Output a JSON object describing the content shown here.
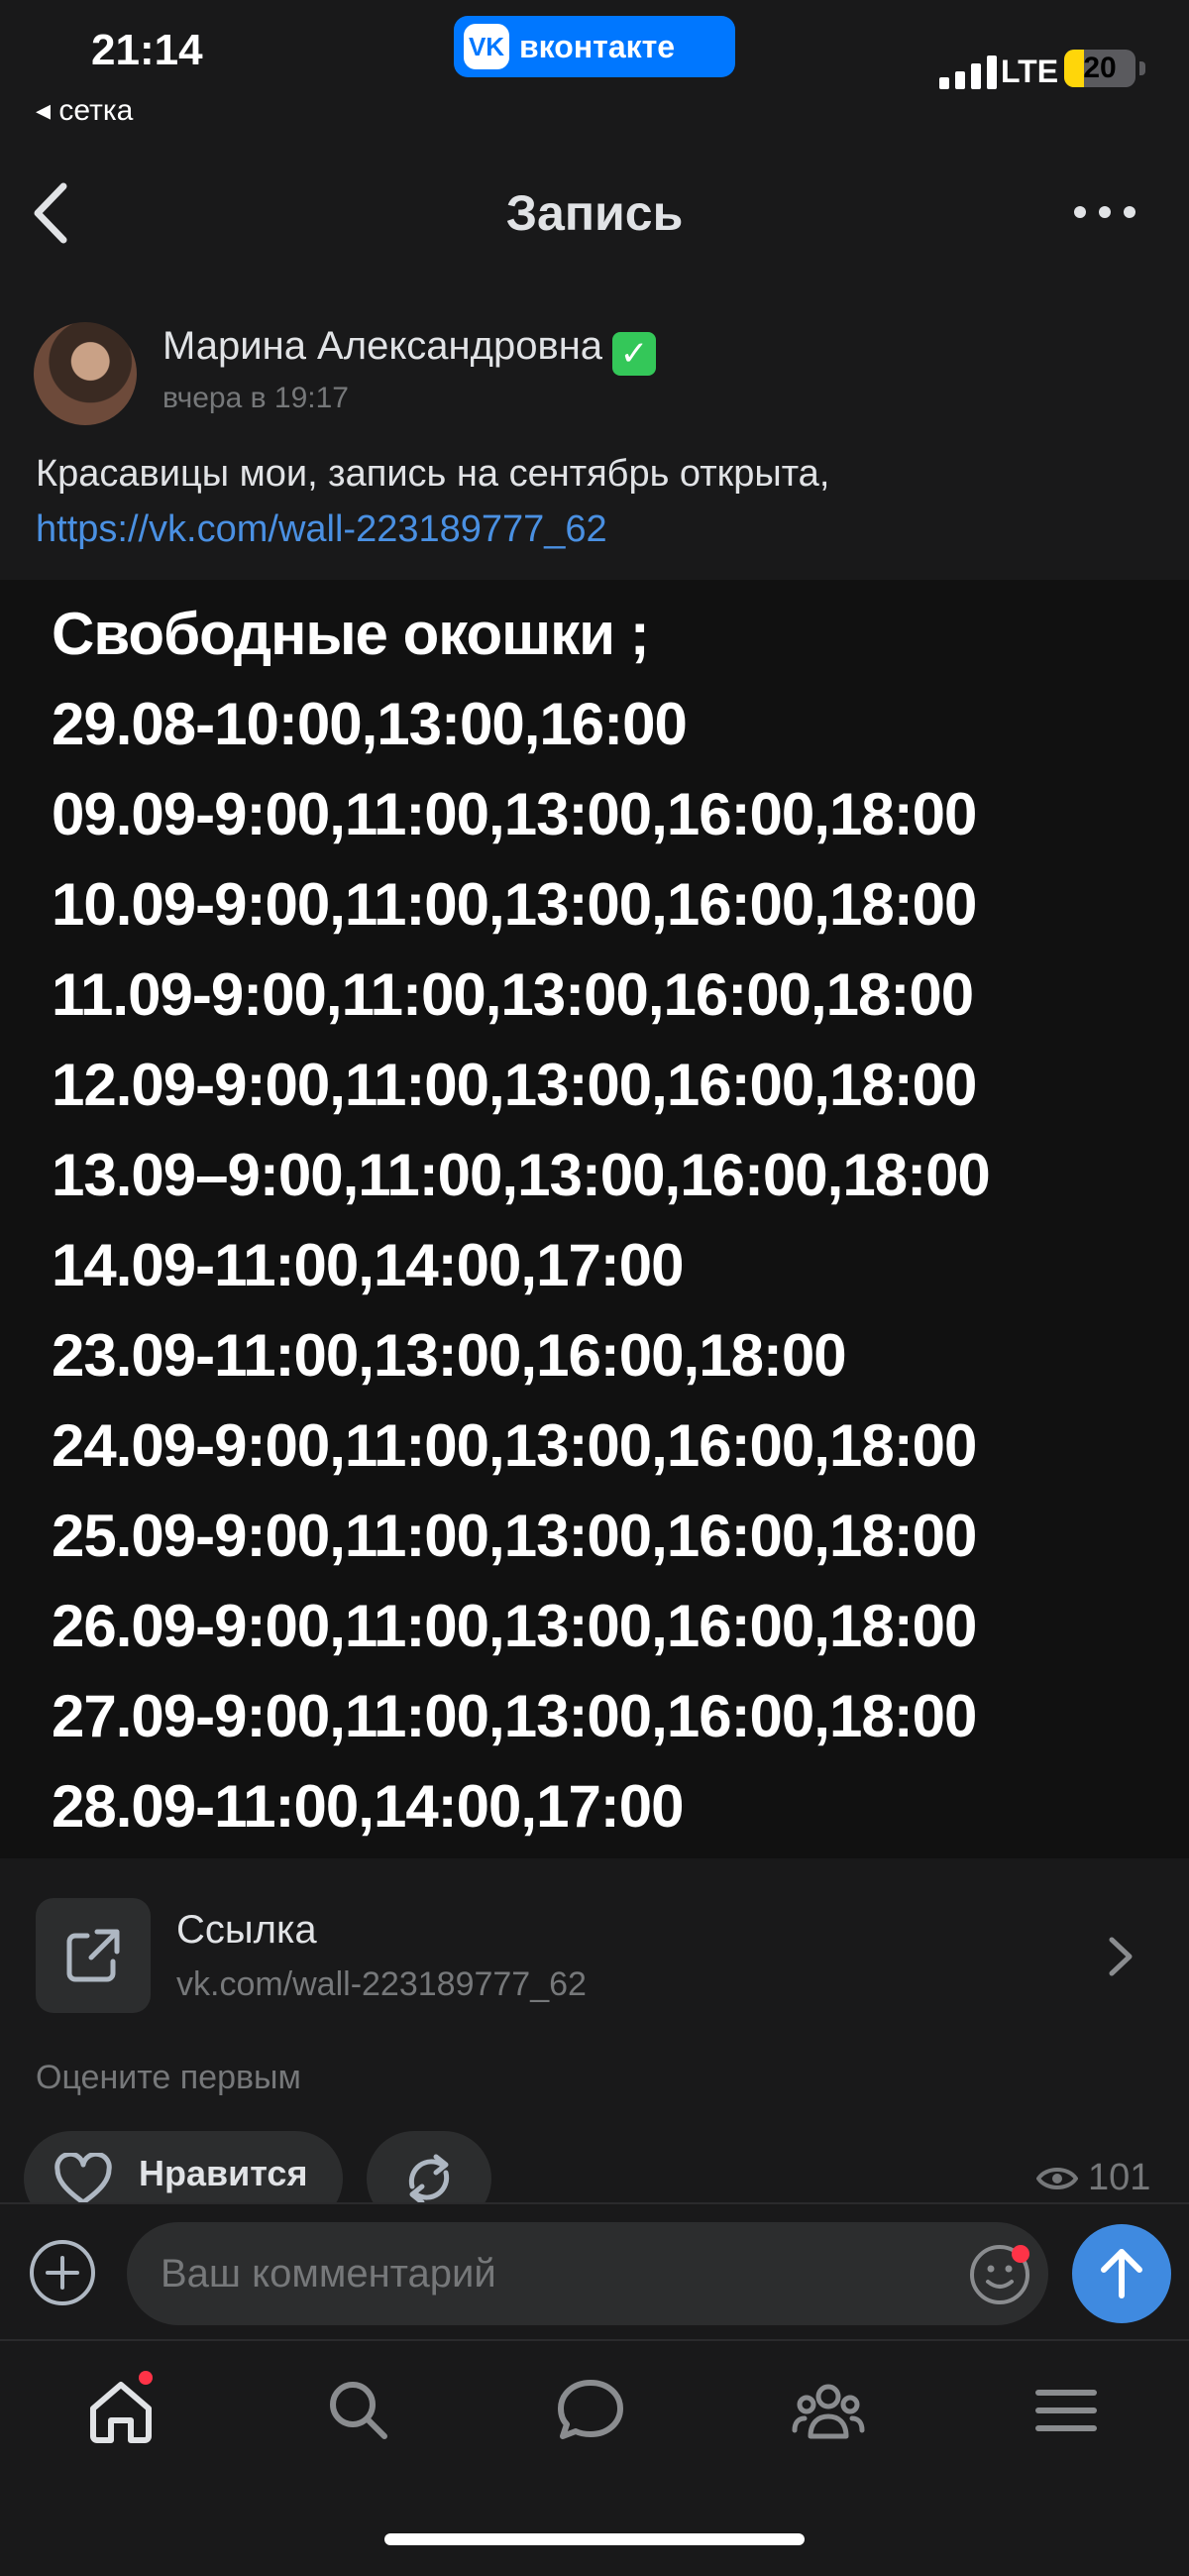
{
  "status_bar": {
    "time": "21:14",
    "app_pill": "вконтакте",
    "app_logo": "VK",
    "back_to_app": "◂ сетка",
    "network": "LTE",
    "battery": "20",
    "battery_level": 0.2
  },
  "nav": {
    "title": "Запись"
  },
  "post": {
    "author": "Марина Александровна",
    "verified_emoji": "✓",
    "time": "вчера в 19:17",
    "text": "Красавицы мои, запись на сентябрь открыта, ",
    "link_text": "https://vk.com/wall-223189777_62",
    "image_lines": [
      "Свободные окошки ;",
      "29.08-10:00,13:00,16:00",
      "09.09-9:00,11:00,13:00,16:00,18:00",
      "10.09-9:00,11:00,13:00,16:00,18:00",
      "11.09-9:00,11:00,13:00,16:00,18:00",
      "12.09-9:00,11:00,13:00,16:00,18:00",
      "13.09–9:00,11:00,13:00,16:00,18:00",
      "14.09-11:00,14:00,17:00",
      "23.09-11:00,13:00,16:00,18:00",
      "24.09-9:00,11:00,13:00,16:00,18:00",
      "25.09-9:00,11:00,13:00,16:00,18:00",
      "26.09-9:00,11:00,13:00,16:00,18:00",
      "27.09-9:00,11:00,13:00,16:00,18:00",
      "28.09-11:00,14:00,17:00"
    ],
    "link_card": {
      "title": "Ссылка",
      "url": "vk.com/wall-223189777_62"
    },
    "rate_prompt": "Оцените первым",
    "like_label": "Нравится",
    "views": "101"
  },
  "comment": {
    "placeholder": "Ваш комментарий"
  },
  "colors": {
    "background": "#19191a",
    "accent": "#3f8ae0",
    "link": "#4a90e2",
    "vk_blue": "#0077ff",
    "notification": "#ff3347"
  },
  "tabs": [
    {
      "name": "home-icon",
      "has_badge": true
    },
    {
      "name": "search-icon"
    },
    {
      "name": "messages-icon"
    },
    {
      "name": "friends-icon"
    },
    {
      "name": "menu-icon"
    }
  ]
}
